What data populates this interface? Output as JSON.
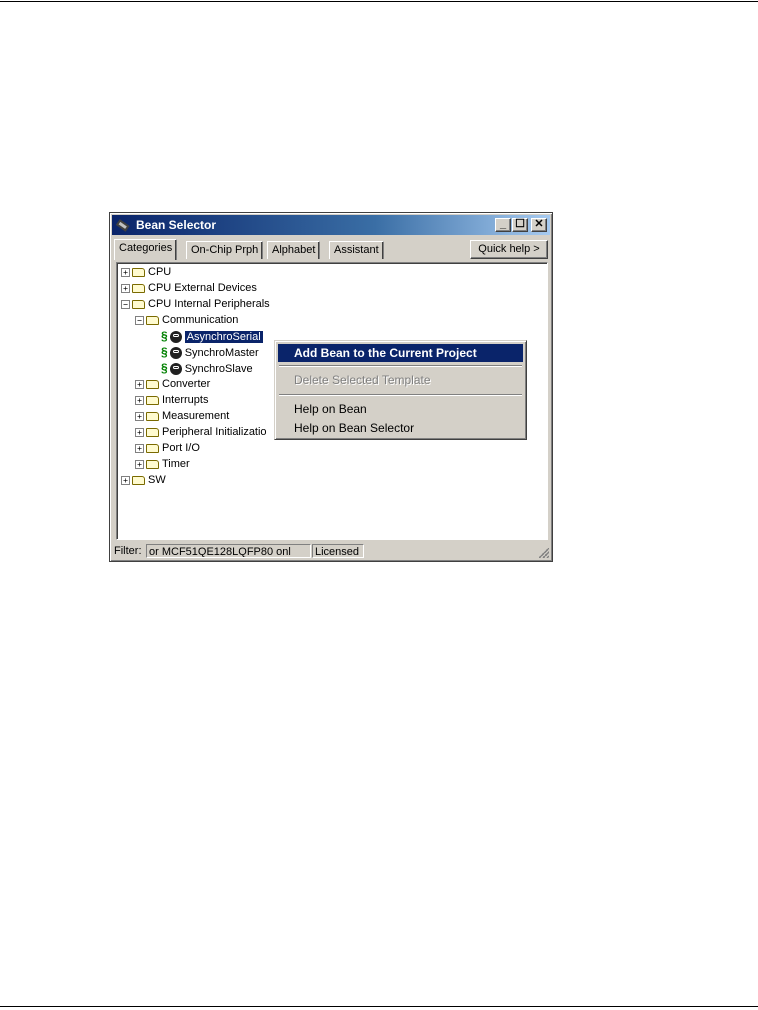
{
  "window": {
    "title": "Bean Selector",
    "controls": {
      "minimize": "_",
      "maximize": "☐",
      "close": "✕"
    }
  },
  "tabs": [
    {
      "label": "Categories",
      "active": true
    },
    {
      "label": "On-Chip Prph",
      "active": false
    },
    {
      "label": "Alphabet",
      "active": false
    },
    {
      "label": "Assistant",
      "active": false
    }
  ],
  "quick_help_label": "Quick help >",
  "tree": {
    "nodes": [
      {
        "label": "CPU",
        "expander": "+",
        "icon": "folder-icon"
      },
      {
        "label": "CPU External Devices",
        "expander": "+",
        "icon": "folder-icon"
      },
      {
        "label": "CPU Internal Peripherals",
        "expander": "−",
        "icon": "folder-icon"
      },
      {
        "label": "Communication",
        "expander": "−",
        "icon": "folder-icon"
      },
      {
        "label": "AsynchroSerial",
        "bean_symbol": "§",
        "icon": "bean-icon",
        "selected": true
      },
      {
        "label": "SynchroMaster",
        "bean_symbol": "§",
        "icon": "bean-icon"
      },
      {
        "label": "SynchroSlave",
        "bean_symbol": "§",
        "icon": "bean-icon"
      },
      {
        "label": "Converter",
        "expander": "+",
        "icon": "folder-icon"
      },
      {
        "label": "Interrupts",
        "expander": "+",
        "icon": "folder-icon"
      },
      {
        "label": "Measurement",
        "expander": "+",
        "icon": "folder-icon"
      },
      {
        "label": "Peripheral Initializatio",
        "expander": "+",
        "icon": "folder-icon"
      },
      {
        "label": "Port I/O",
        "expander": "+",
        "icon": "folder-icon"
      },
      {
        "label": "Timer",
        "expander": "+",
        "icon": "folder-icon"
      },
      {
        "label": "SW",
        "expander": "+",
        "icon": "folder-icon"
      }
    ]
  },
  "context_menu": {
    "items": [
      {
        "label": "Add Bean to the Current Project",
        "highlighted": true
      },
      {
        "label": "Delete Selected Template",
        "disabled": true
      },
      {
        "label": "Help on Bean"
      },
      {
        "label": "Help on Bean Selector"
      }
    ]
  },
  "status_bar": {
    "filter_label": "Filter:",
    "filter_value": "or MCF51QE128LQFP80 onl",
    "license": "Licensed"
  },
  "colors": {
    "selection": "#0a246a",
    "window_face": "#d4d0c8",
    "bean_symbol": "#008000"
  }
}
